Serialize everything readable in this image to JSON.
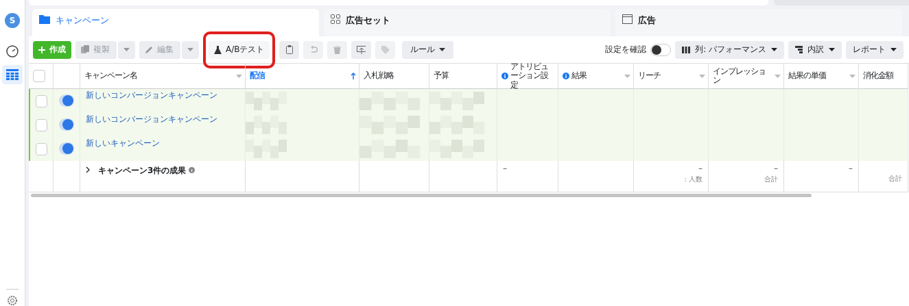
{
  "sidebar": {
    "avatar": "S",
    "items": [
      {
        "kind": "gauge",
        "selected": false
      },
      {
        "kind": "table",
        "selected": true
      }
    ]
  },
  "tabs": [
    {
      "kind": "campaign",
      "label": "キャンペーン",
      "selected": true
    },
    {
      "kind": "adset",
      "label": "広告セット",
      "selected": false
    },
    {
      "kind": "ad",
      "label": "広告",
      "selected": false
    }
  ],
  "toolbar": {
    "left": [
      {
        "kind": "create",
        "label": "作成"
      },
      {
        "kind": "duplicate",
        "label": "複製",
        "disabled": true
      },
      {
        "kind": "edit",
        "label": "編集",
        "disabled": true
      },
      {
        "kind": "abtest",
        "label": "A/Bテスト",
        "highlighted": true
      },
      {
        "kind": "clipboard",
        "disabled": false
      },
      {
        "kind": "undo",
        "disabled": true
      },
      {
        "kind": "delete",
        "disabled": true
      },
      {
        "kind": "export",
        "disabled": false
      },
      {
        "kind": "tag",
        "disabled": true
      },
      {
        "kind": "rules",
        "label": "ルール",
        "disabled": false
      }
    ],
    "review": {
      "label": "設定を確認",
      "on": false
    },
    "right": [
      {
        "kind": "columns",
        "label": "列: パフォーマンス"
      },
      {
        "kind": "breakdown",
        "label": "内訳"
      },
      {
        "kind": "report",
        "label": "レポート"
      }
    ]
  },
  "table": {
    "all_checked": false,
    "columns": [
      {
        "label": "キャンペーン名",
        "caret": true,
        "info": false,
        "sorted": false
      },
      {
        "label": "配信",
        "caret": false,
        "info": false,
        "sorted": true
      },
      {
        "label": "入札戦略",
        "caret": false,
        "info": false,
        "sorted": false
      },
      {
        "label": "予算",
        "caret": false,
        "info": false,
        "sorted": false
      },
      {
        "label": "アトリビューション設定",
        "caret": false,
        "info": true,
        "sorted": false,
        "total": "–"
      },
      {
        "label": "結果",
        "caret": true,
        "info": true,
        "sorted": false
      },
      {
        "label": "リーチ",
        "caret": true,
        "info": false,
        "sorted": false,
        "total": "–",
        "total_note": ": 人数"
      },
      {
        "label": "インプレッション",
        "caret": true,
        "info": false,
        "sorted": false,
        "total": "–",
        "total_note": "合計"
      },
      {
        "label": "結果の単価",
        "caret": true,
        "info": false,
        "sorted": false,
        "total": "–"
      },
      {
        "label": "消化金額",
        "caret": false,
        "info": false,
        "sorted": false,
        "total_note": "合計"
      }
    ],
    "rows": [
      {
        "name": "新しいコンバージョンキャンペーン",
        "checked": false,
        "on": true
      },
      {
        "name": "新しいコンバージョンキャンペーン",
        "checked": false,
        "on": true
      },
      {
        "name": "新しいキャンペーン",
        "checked": false,
        "on": true
      }
    ],
    "summary": {
      "label": "キャンペーン3件の成果",
      "expanded": false
    }
  }
}
